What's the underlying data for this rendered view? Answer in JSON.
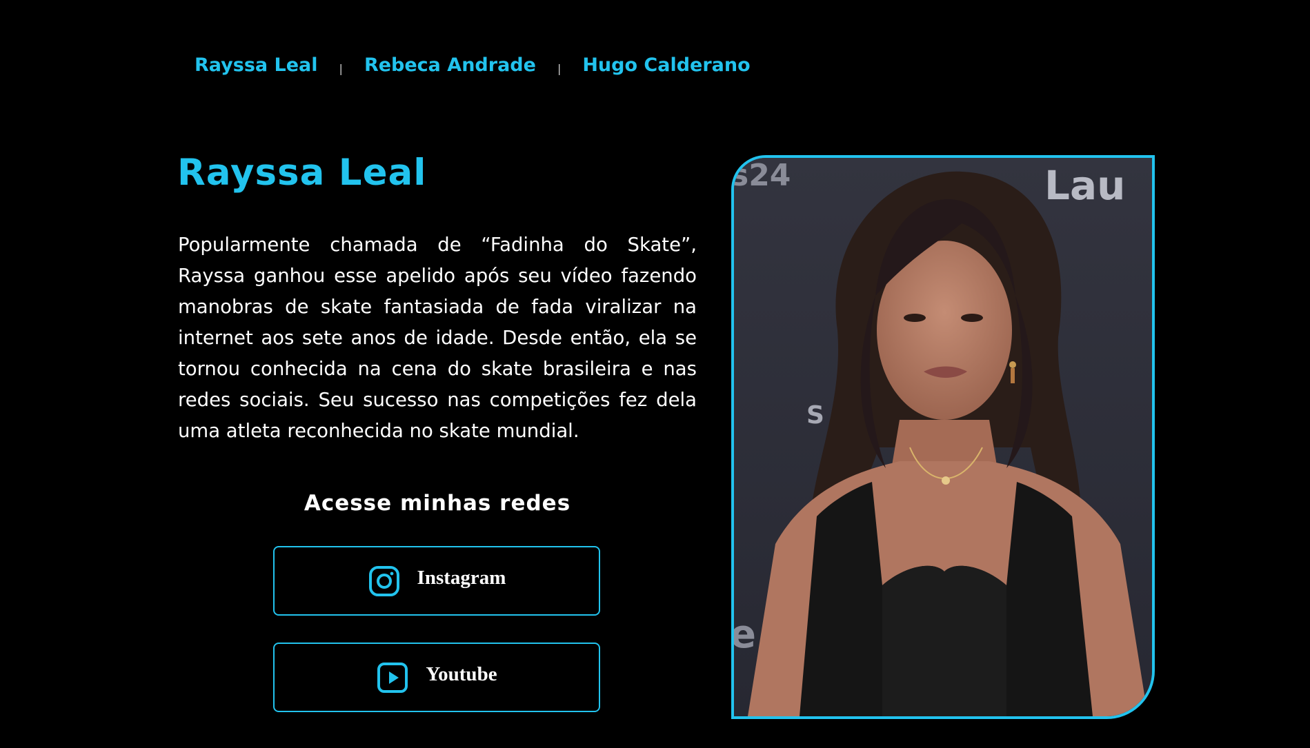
{
  "nav": {
    "items": [
      {
        "label": "Rayssa Leal"
      },
      {
        "label": "Rebeca Andrade"
      },
      {
        "label": "Hugo Calderano"
      }
    ],
    "separator": "|"
  },
  "athlete": {
    "name": "Rayssa Leal",
    "bio": "Popularmente chamada de “Fadinha do Skate”, Rayssa ganhou esse apelido após seu vídeo fazendo manobras de skate fantasiada de fada viralizar na internet aos sete anos de idade. Desde então, ela se tornou conhecida na cena do skate brasileira e nas redes sociais. Seu sucesso nas competições fez dela uma atleta reconhecida no skate mundial.",
    "photo_backdrop_text": {
      "top_left": "s24",
      "top_right": "Lau",
      "middle_left": "S",
      "bottom_left": "e"
    }
  },
  "socials": {
    "title": "Acesse minhas redes",
    "buttons": [
      {
        "label": "Instagram",
        "icon": "instagram-icon"
      },
      {
        "label": "Youtube",
        "icon": "youtube-icon"
      }
    ]
  },
  "colors": {
    "accent": "#22c3ee",
    "background": "#000000",
    "text": "#ffffff"
  }
}
